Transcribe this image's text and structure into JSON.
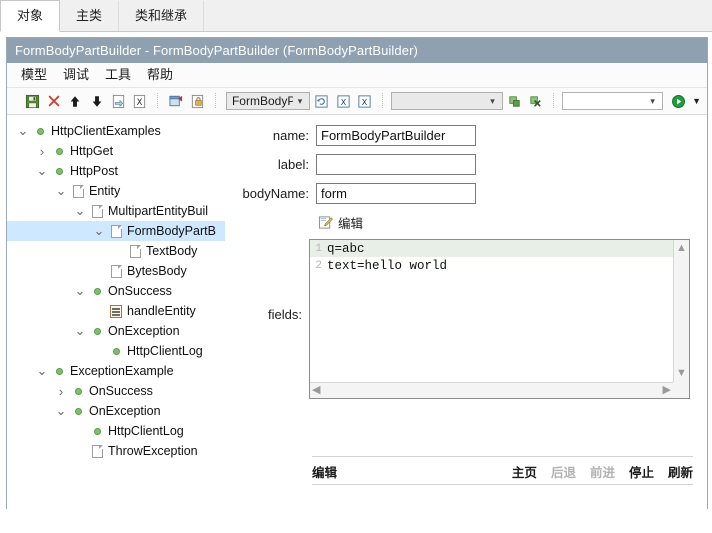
{
  "tabs": [
    {
      "label": "对象",
      "active": true
    },
    {
      "label": "主类",
      "active": false
    },
    {
      "label": "类和继承",
      "active": false
    }
  ],
  "window": {
    "title": "FormBodyPartBuilder - FormBodyPartBuilder  (FormBodyPartBuilder)"
  },
  "menu": [
    "模型",
    "调试",
    "工具",
    "帮助"
  ],
  "toolbar": {
    "icons": [
      "save-icon",
      "delete-icon",
      "move-up-icon",
      "move-down-icon",
      "import-icon",
      "excel-icon",
      "table-icon",
      "lock-icon"
    ],
    "combo_class": "FormBodyP",
    "combo_class_options": [
      "FormBodyP"
    ],
    "combo_empty_1": "",
    "combo_empty_2": "",
    "run_icon": "run-icon",
    "run_dropdown_icon": "chevron-down-icon"
  },
  "tree": [
    {
      "label": "HttpClientExamples",
      "depth": 0,
      "twist": "expanded",
      "icon": "node-dot",
      "selected": false
    },
    {
      "label": "HttpGet",
      "depth": 1,
      "twist": "collapsed",
      "icon": "node-dot",
      "selected": false
    },
    {
      "label": "HttpPost",
      "depth": 1,
      "twist": "expanded",
      "icon": "node-dot",
      "selected": false
    },
    {
      "label": "Entity",
      "depth": 2,
      "twist": "expanded",
      "icon": "doc",
      "selected": false
    },
    {
      "label": "MultipartEntityBuil",
      "depth": 3,
      "twist": "expanded",
      "icon": "doc",
      "selected": false
    },
    {
      "label": "FormBodyPartB",
      "depth": 4,
      "twist": "expanded",
      "icon": "doc",
      "selected": true
    },
    {
      "label": "TextBody",
      "depth": 5,
      "twist": "none",
      "icon": "doc",
      "selected": false
    },
    {
      "label": "BytesBody",
      "depth": 4,
      "twist": "none",
      "icon": "doc",
      "selected": false
    },
    {
      "label": "OnSuccess",
      "depth": 3,
      "twist": "expanded",
      "icon": "node-dot",
      "selected": false
    },
    {
      "label": "handleEntity",
      "depth": 4,
      "twist": "none",
      "icon": "method",
      "selected": false
    },
    {
      "label": "OnException",
      "depth": 3,
      "twist": "expanded",
      "icon": "node-dot",
      "selected": false
    },
    {
      "label": "HttpClientLog",
      "depth": 4,
      "twist": "none",
      "icon": "node-dot",
      "selected": false
    },
    {
      "label": "ExceptionExample",
      "depth": 1,
      "twist": "expanded",
      "icon": "node-dot",
      "selected": false
    },
    {
      "label": "OnSuccess",
      "depth": 2,
      "twist": "collapsed",
      "icon": "node-dot",
      "selected": false
    },
    {
      "label": "OnException",
      "depth": 2,
      "twist": "expanded",
      "icon": "node-dot",
      "selected": false
    },
    {
      "label": "HttpClientLog",
      "depth": 3,
      "twist": "none",
      "icon": "node-dot",
      "selected": false
    },
    {
      "label": "ThrowException",
      "depth": 3,
      "twist": "none",
      "icon": "doc",
      "selected": false
    }
  ],
  "form": {
    "name_label": "name:",
    "name_value": "FormBodyPartBuilder",
    "label_label": "label:",
    "label_value": "",
    "bodyName_label": "bodyName:",
    "bodyName_value": "form",
    "edit_button": "编辑",
    "fields_label": "fields:"
  },
  "editor": {
    "lines": [
      {
        "num": "1",
        "text": "q=abc",
        "highlight": true
      },
      {
        "num": "2",
        "text": "text=hello world",
        "highlight": false
      }
    ],
    "scroll_up_icon": "chevron-up-icon",
    "scroll_down_icon": "chevron-down-icon",
    "scroll_left_icon": "chevron-left-icon",
    "scroll_right_icon": "chevron-right-icon"
  },
  "statusbar": {
    "left": "编辑",
    "items": [
      {
        "label": "主页",
        "disabled": false
      },
      {
        "label": "后退",
        "disabled": true
      },
      {
        "label": "前进",
        "disabled": true
      },
      {
        "label": "停止",
        "disabled": false
      },
      {
        "label": "刷新",
        "disabled": false
      }
    ]
  }
}
